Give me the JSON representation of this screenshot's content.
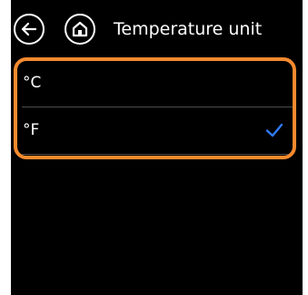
{
  "header": {
    "title": "Temperature unit",
    "back_icon": "back-arrow-icon",
    "home_icon": "home-icon"
  },
  "options": [
    {
      "label": "°C",
      "selected": false
    },
    {
      "label": "°F",
      "selected": true
    }
  ],
  "colors": {
    "background": "#000000",
    "highlight_border": "#f58a2e",
    "check": "#2f7bf5",
    "divider": "#4b4b4b",
    "text": "#ffffff"
  },
  "icons": {
    "selected_marker": "checkmark-icon"
  }
}
